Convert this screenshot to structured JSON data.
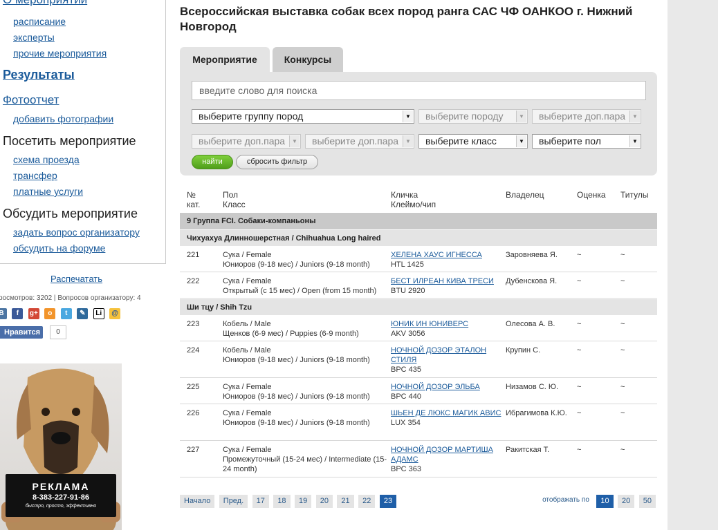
{
  "sidebar": {
    "top_cut_link": "О мероприятии",
    "event_links": [
      "расписание",
      "эксперты",
      "прочие мероприятия"
    ],
    "results_link": "Результаты",
    "photo_link": "Фотоотчет",
    "add_photos_link": "добавить фотографии",
    "visit_heading": "Посетить мероприятие",
    "visit_links": [
      "схема проезда",
      "трансфер",
      "платные услуги"
    ],
    "discuss_heading": "Обсудить мероприятие",
    "discuss_links": [
      "задать вопрос организатору",
      "обсудить на форуме"
    ],
    "print_link": "Распечатать",
    "stats": "росмотров: 3202 | Вопросов организатору: 4",
    "social_icons": [
      "vk-icon",
      "facebook-icon",
      "googleplus-icon",
      "odnoklassniki-icon",
      "twitter-icon",
      "livejournal-icon",
      "liveinternet-icon",
      "mailru-icon"
    ],
    "like_label": "Нравится",
    "like_count": "0"
  },
  "ad": {
    "title": "РЕКЛАМА",
    "phone": "8-383-227-91-86",
    "slogan": "быстро, просто, эффективно"
  },
  "main": {
    "title": "Всероссийская выставка собак всех пород ранга САС ЧФ ОАНКОО г. Нижний Новгород",
    "tabs": [
      {
        "label": "Мероприятие",
        "active": true
      },
      {
        "label": "Конкурсы",
        "active": false
      }
    ],
    "filter": {
      "search_placeholder": "введите слово для поиска",
      "row1": [
        {
          "label": "выберите группу пород",
          "enabled": true
        },
        {
          "label": "выберите породу",
          "enabled": false
        },
        {
          "label": "выберите доп.пара",
          "enabled": false
        }
      ],
      "row2": [
        {
          "label": "выберите доп.пара",
          "enabled": false
        },
        {
          "label": "выберите доп.пара",
          "enabled": false
        },
        {
          "label": "выберите класс",
          "enabled": true
        },
        {
          "label": "выберите пол",
          "enabled": true
        }
      ],
      "find_label": "найти",
      "reset_label": "сбросить фильтр"
    },
    "table": {
      "headers": {
        "num_line1": "№",
        "num_line2": "кат.",
        "sex_line1": "Пол",
        "sex_line2": "Класс",
        "name_line1": "Кличка",
        "name_line2": "Клеймо/чип",
        "owner": "Владелец",
        "grade": "Оценка",
        "titles": "Титулы"
      },
      "group": "9 Группа FCI. Собаки-компаньоны",
      "breeds": [
        {
          "name": "Чихуахуа Длинношерстная / Chihuahua Long haired",
          "rows": [
            {
              "num": "221",
              "sex": "Сука / Female",
              "class": "Юниоров (9-18 мес) / Juniors (9-18 month)",
              "dog": "ХЕЛЕНА ХАУС ИГНЕССА",
              "brand": "HTL 1425",
              "owner": "Заровняева Я.",
              "grade": "~",
              "titles": "~"
            },
            {
              "num": "222",
              "sex": "Сука / Female",
              "class": "Открытый (с 15 мес) / Open (from 15 month)",
              "dog": "БЕСТ ИЛРЕАН КИВА ТРЕСИ",
              "brand": "BTU 2920",
              "owner": "Дубенскова Я.",
              "grade": "~",
              "titles": "~"
            }
          ]
        },
        {
          "name": "Ши тцу / Shih Tzu",
          "rows": [
            {
              "num": "223",
              "sex": "Кобель / Male",
              "class": "Щенков (6-9 мес) / Puppies (6-9 month)",
              "dog": "ЮНИК ИН ЮНИВЕРС",
              "brand": "AKV 3056",
              "owner": "Олесова А. В.",
              "grade": "~",
              "titles": "~"
            },
            {
              "num": "224",
              "sex": "Кобель / Male",
              "class": "Юниоров (9-18 мес) / Juniors (9-18 month)",
              "dog": "НОЧНОЙ ДОЗОР ЭТАЛОН СТИЛЯ",
              "brand": "BPC 435",
              "owner": "Крупин С.",
              "grade": "~",
              "titles": "~"
            },
            {
              "num": "225",
              "sex": "Сука / Female",
              "class": "Юниоров (9-18 мес) / Juniors (9-18 month)",
              "dog": "НОЧНОЙ ДОЗОР ЭЛЬБА",
              "brand": "BPC 440",
              "owner": "Низамов С. Ю.",
              "grade": "~",
              "titles": "~"
            },
            {
              "num": "226",
              "sex": "Сука / Female",
              "class": "Юниоров (9-18 мес) / Juniors (9-18 month)",
              "dog": "ШЬЕН ДЕ ЛЮКС МАГИК АВИС",
              "brand": "LUX 354",
              "owner": "Ибрагимова К.Ю.",
              "grade": "~",
              "titles": "~"
            },
            {
              "num": "227",
              "sex": "Сука / Female",
              "class": "Промежуточный (15-24 мес) / Intermediate (15-24 month)",
              "dog": "НОЧНОЙ ДОЗОР МАРТИША АДАМС",
              "brand": "BPC 363",
              "owner": "Ракитская Т.",
              "grade": "~",
              "titles": "~"
            }
          ]
        }
      ]
    },
    "pagination": {
      "first": "Начало",
      "prev": "Пред.",
      "pages": [
        "17",
        "18",
        "19",
        "20",
        "21",
        "22",
        "23"
      ],
      "current": "23",
      "per_page_label": "отображать по",
      "per_page_options": [
        "10",
        "20",
        "50"
      ],
      "per_page_current": "10"
    }
  },
  "colors": {
    "link": "#1a5a9a",
    "find_button": "#5fae22",
    "pager_active": "#1f5fa8",
    "panel_bg": "#e4e4e4"
  }
}
